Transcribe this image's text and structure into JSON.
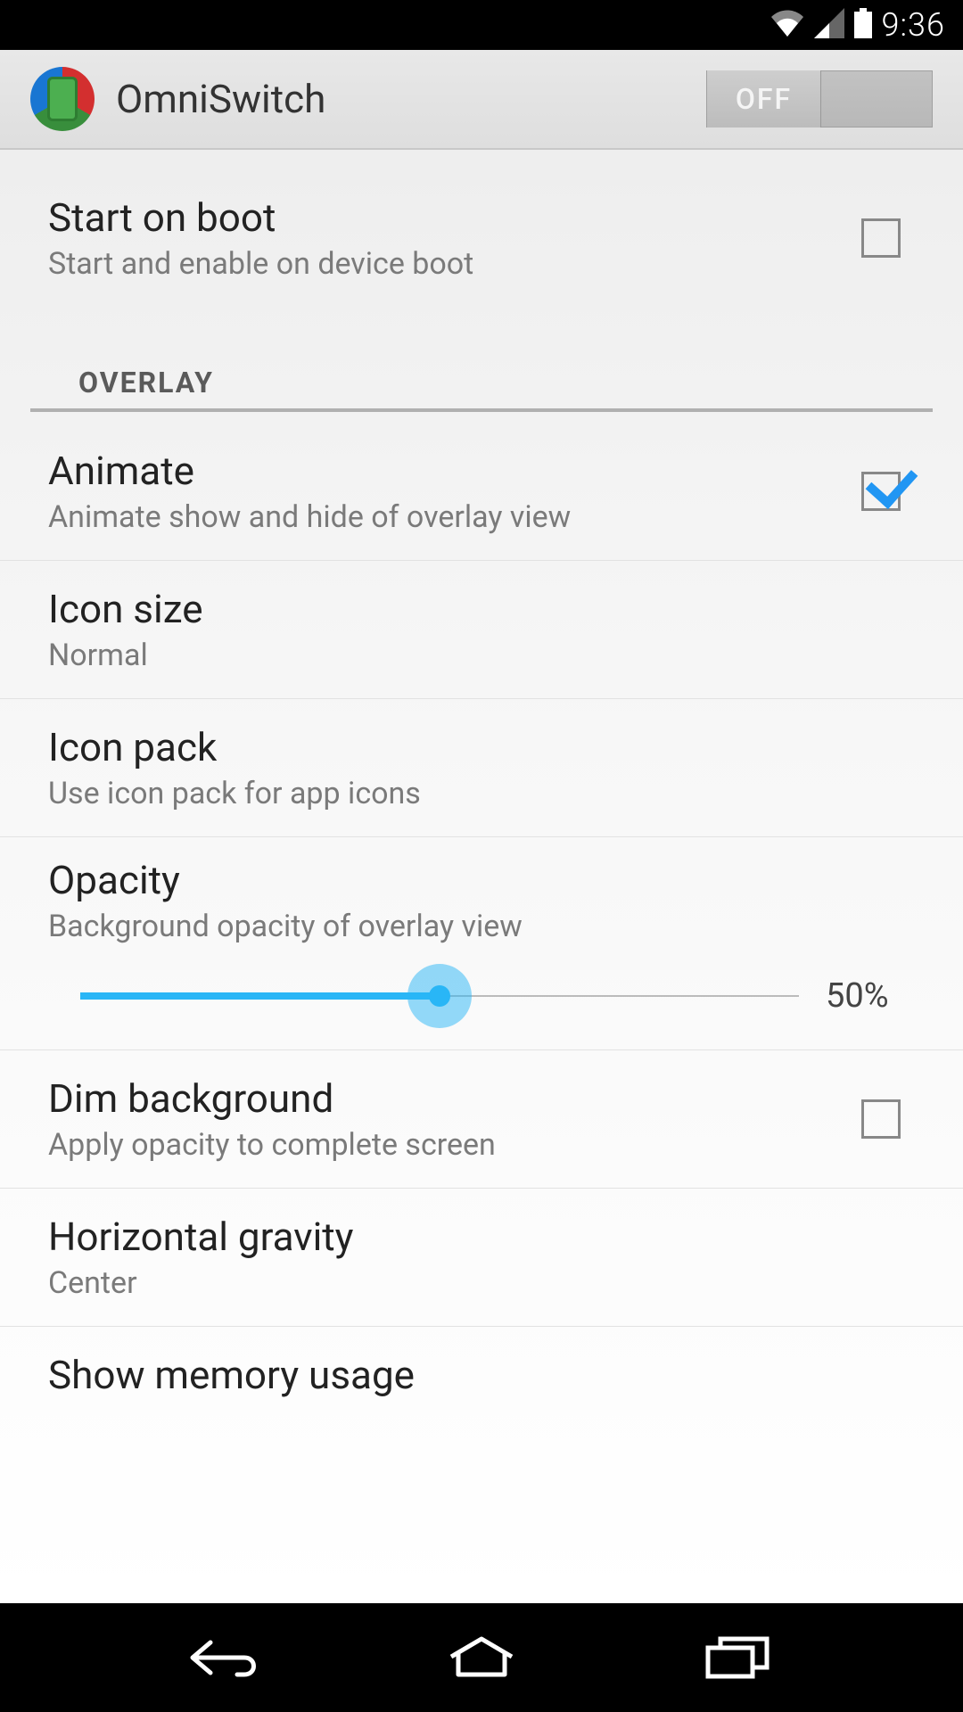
{
  "status": {
    "time": "9:36"
  },
  "header": {
    "title": "OmniSwitch",
    "toggle_label": "OFF"
  },
  "settings": {
    "start_on_boot": {
      "title": "Start on boot",
      "sub": "Start and enable on device boot",
      "checked": false
    },
    "section_overlay": "OVERLAY",
    "animate": {
      "title": "Animate",
      "sub": "Animate show and hide of overlay view",
      "checked": true
    },
    "icon_size": {
      "title": "Icon size",
      "sub": "Normal"
    },
    "icon_pack": {
      "title": "Icon pack",
      "sub": "Use icon pack for app icons"
    },
    "opacity": {
      "title": "Opacity",
      "sub": "Background opacity of overlay view",
      "value_label": "50%",
      "value_percent": 50
    },
    "dim_background": {
      "title": "Dim background",
      "sub": "Apply opacity to complete screen",
      "checked": false
    },
    "horizontal_gravity": {
      "title": "Horizontal gravity",
      "sub": "Center"
    },
    "show_memory": {
      "title": "Show memory usage"
    }
  }
}
